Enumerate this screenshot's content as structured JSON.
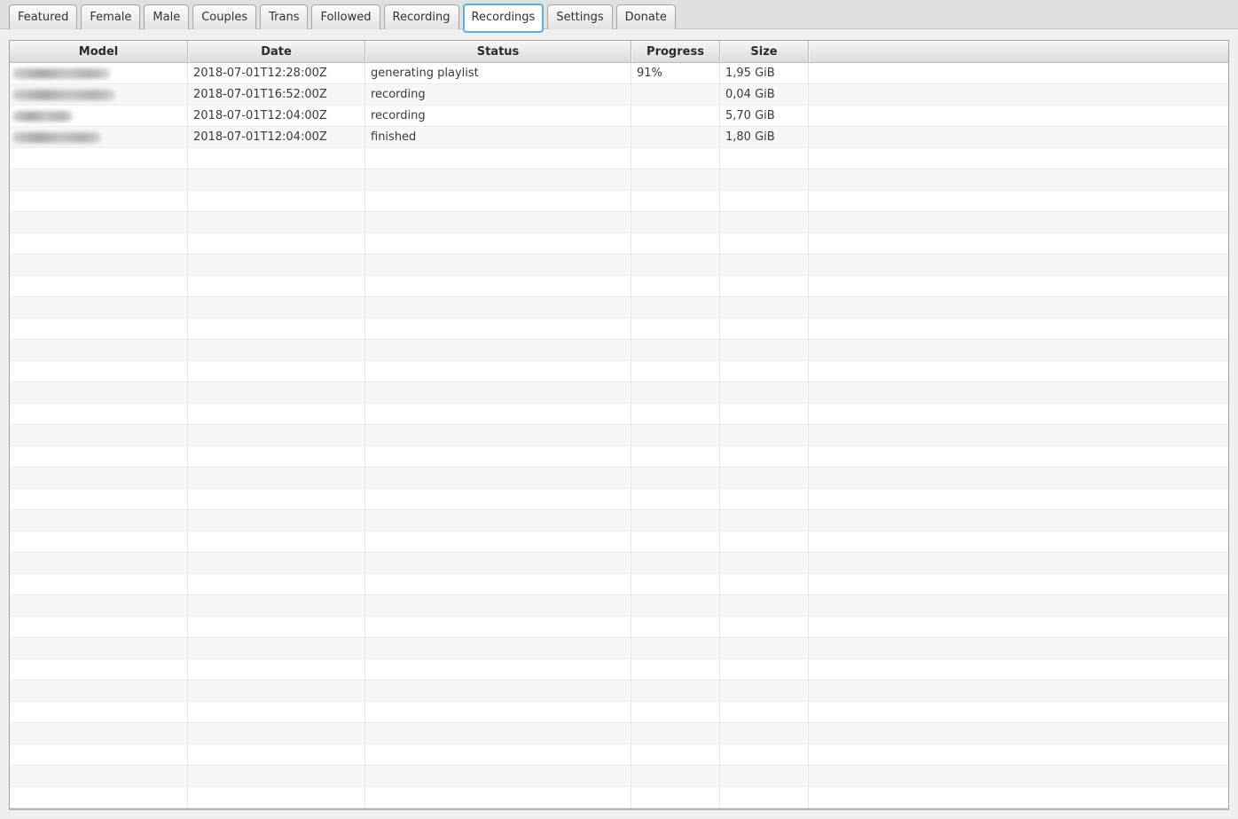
{
  "tab_bar": {
    "tabs": [
      {
        "label": "Featured",
        "selected": false
      },
      {
        "label": "Female",
        "selected": false
      },
      {
        "label": "Male",
        "selected": false
      },
      {
        "label": "Couples",
        "selected": false
      },
      {
        "label": "Trans",
        "selected": false
      },
      {
        "label": "Followed",
        "selected": false
      },
      {
        "label": "Recording",
        "selected": false
      },
      {
        "label": "Recordings",
        "selected": true
      },
      {
        "label": "Settings",
        "selected": false
      },
      {
        "label": "Donate",
        "selected": false
      }
    ]
  },
  "recordings_table": {
    "columns": [
      {
        "label": "Model"
      },
      {
        "label": "Date"
      },
      {
        "label": "Status"
      },
      {
        "label": "Progress"
      },
      {
        "label": "Size"
      },
      {
        "label": ""
      }
    ],
    "rows": [
      {
        "model": "",
        "model_redacted": true,
        "redaction_width": 110,
        "date": "2018-07-01T12:28:00Z",
        "status": "generating playlist",
        "progress": "91%",
        "size": "1,95 GiB"
      },
      {
        "model": "",
        "model_redacted": true,
        "redaction_width": 116,
        "date": "2018-07-01T16:52:00Z",
        "status": "recording",
        "progress": "",
        "size": "0,04 GiB"
      },
      {
        "model": "",
        "model_redacted": true,
        "redaction_width": 68,
        "date": "2018-07-01T12:04:00Z",
        "status": "recording",
        "progress": "",
        "size": "5,70 GiB"
      },
      {
        "model": "",
        "model_redacted": true,
        "redaction_width": 100,
        "date": "2018-07-01T12:04:00Z",
        "status": "finished",
        "progress": "",
        "size": "1,80 GiB"
      }
    ],
    "empty_row_count": 31
  },
  "colors": {
    "page_background": "#f0f0f0",
    "tabbar_background": "#e1e1e1",
    "selected_tab_accent": "#5ab2da",
    "row_alt_background": "#f7f7f7",
    "header_text": "#2b2b2b",
    "cell_text": "#3a3a3a",
    "table_border": "#a2a2a2"
  }
}
